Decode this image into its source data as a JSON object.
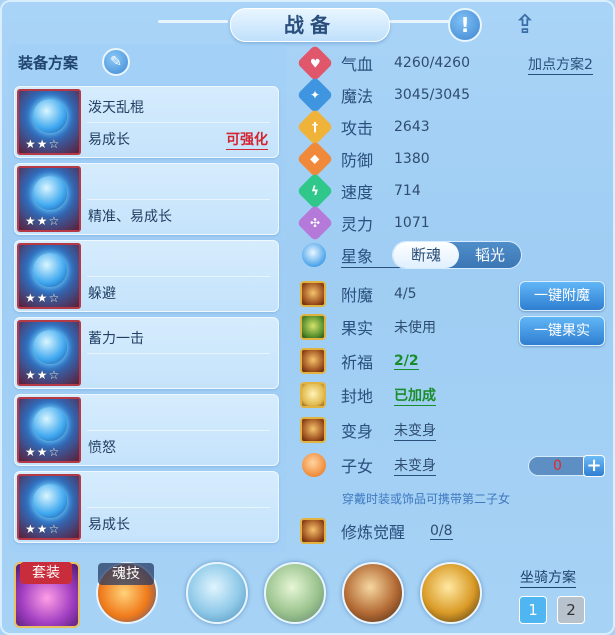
{
  "title": "战备",
  "equip_plan_label": "装备方案",
  "add_point_plan": "加点方案2",
  "equipment": [
    {
      "name": "泼天乱棍",
      "sub": "易成长",
      "tag": "可强化",
      "stars": "★★☆"
    },
    {
      "name": "",
      "sub": "精准、易成长",
      "tag": "",
      "stars": "★★☆"
    },
    {
      "name": "",
      "sub": "躲避",
      "tag": "",
      "stars": "★★☆"
    },
    {
      "name": "蓄力一击",
      "sub": "",
      "tag": "",
      "stars": "★★☆"
    },
    {
      "name": "",
      "sub": "愤怒",
      "tag": "",
      "stars": "★★☆"
    },
    {
      "name": "",
      "sub": "易成长",
      "tag": "",
      "stars": "★★☆"
    }
  ],
  "stats": [
    {
      "label": "气血",
      "value": "4260/4260",
      "icon": "heart-icon",
      "color": "#e0566a"
    },
    {
      "label": "魔法",
      "value": "3045/3045",
      "icon": "mana-icon",
      "color": "#3f95e0"
    },
    {
      "label": "攻击",
      "value": "2643",
      "icon": "sword-icon",
      "color": "#f0b33a"
    },
    {
      "label": "防御",
      "value": "1380",
      "icon": "shield-icon",
      "color": "#f08a3a"
    },
    {
      "label": "速度",
      "value": "714",
      "icon": "speed-icon",
      "color": "#2fc78a"
    },
    {
      "label": "灵力",
      "value": "1071",
      "icon": "spirit-icon",
      "color": "#b57ad9"
    }
  ],
  "star_sign": {
    "label": "星象",
    "option_on": "断魂",
    "option_off": "韬光"
  },
  "extras": [
    {
      "label": "附魔",
      "value": "4/5",
      "button": "一键附魔"
    },
    {
      "label": "果实",
      "value": "未使用",
      "button": "一键果实"
    },
    {
      "label": "祈福",
      "value": "2/2",
      "button": ""
    },
    {
      "label": "封地",
      "value": "已加成",
      "button": ""
    },
    {
      "label": "变身",
      "value": "未变身",
      "button": ""
    },
    {
      "label": "子女",
      "value": "未变身",
      "button": ""
    }
  ],
  "child_count": "0",
  "hint": "穿戴时装或饰品可携带第二子女",
  "cultivation": {
    "label": "修炼觉醒",
    "value": "0/8"
  },
  "bottom": {
    "suit_label": "套装",
    "soul_label": "魂技",
    "mount_plan_label": "坐骑方案",
    "mount_1": "1",
    "mount_2": "2"
  }
}
